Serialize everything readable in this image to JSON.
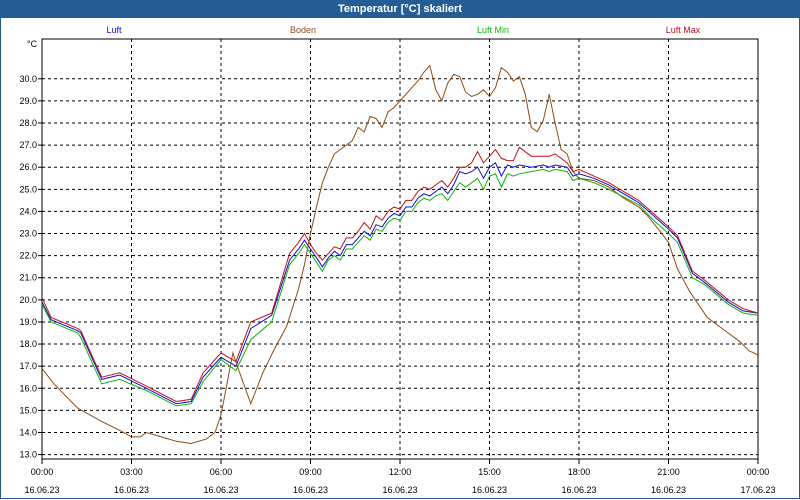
{
  "window": {
    "title": "Temperatur [°C] skaliert"
  },
  "chart_data": {
    "type": "line",
    "title": "Temperatur [°C] skaliert",
    "ylabel": "°C",
    "ylim": [
      12.8,
      31.8
    ],
    "yticks": [
      "13.0",
      "14.0",
      "15.0",
      "16.0",
      "17.0",
      "18.0",
      "19.0",
      "20.0",
      "21.0",
      "22.0",
      "23.0",
      "24.0",
      "25.0",
      "26.0",
      "27.0",
      "28.0",
      "29.0",
      "30.0"
    ],
    "xticks": [
      {
        "time": "00:00",
        "date": "16.06.23"
      },
      {
        "time": "03:00",
        "date": "16.06.23"
      },
      {
        "time": "06:00",
        "date": "16.06.23"
      },
      {
        "time": "09:00",
        "date": "16.06.23"
      },
      {
        "time": "12:00",
        "date": "16.06.23"
      },
      {
        "time": "15:00",
        "date": "16.06.23"
      },
      {
        "time": "18:00",
        "date": "16.06.23"
      },
      {
        "time": "21:00",
        "date": "16.06.23"
      },
      {
        "time": "00:00",
        "date": "17.06.23"
      }
    ],
    "x_range_hours": [
      0,
      24
    ],
    "grid": true,
    "series": [
      {
        "name": "Luft",
        "color": "#1010c8",
        "points": [
          [
            0,
            19.9
          ],
          [
            0.3,
            19.1
          ],
          [
            1.2,
            18.6
          ],
          [
            1.3,
            18.5
          ],
          [
            2.0,
            16.4
          ],
          [
            2.6,
            16.6
          ],
          [
            3.5,
            16.0
          ],
          [
            4.5,
            15.3
          ],
          [
            5.0,
            15.4
          ],
          [
            5.4,
            16.5
          ],
          [
            6.0,
            17.4
          ],
          [
            6.5,
            17.0
          ],
          [
            7.0,
            18.7
          ],
          [
            7.7,
            19.3
          ],
          [
            8.3,
            21.8
          ],
          [
            8.6,
            22.3
          ],
          [
            8.8,
            22.7
          ],
          [
            9.0,
            22.3
          ],
          [
            9.2,
            21.9
          ],
          [
            9.4,
            21.5
          ],
          [
            9.6,
            21.9
          ],
          [
            9.8,
            22.2
          ],
          [
            10.0,
            22.0
          ],
          [
            10.2,
            22.5
          ],
          [
            10.4,
            22.5
          ],
          [
            10.6,
            22.8
          ],
          [
            10.8,
            23.1
          ],
          [
            11.0,
            22.9
          ],
          [
            11.2,
            23.4
          ],
          [
            11.4,
            23.3
          ],
          [
            11.6,
            23.7
          ],
          [
            11.8,
            23.9
          ],
          [
            12.0,
            23.8
          ],
          [
            12.2,
            24.2
          ],
          [
            12.4,
            24.2
          ],
          [
            12.6,
            24.6
          ],
          [
            12.8,
            24.8
          ],
          [
            13.0,
            24.7
          ],
          [
            13.2,
            24.9
          ],
          [
            13.4,
            25.1
          ],
          [
            13.6,
            24.8
          ],
          [
            13.8,
            25.2
          ],
          [
            14.0,
            25.8
          ],
          [
            14.2,
            25.7
          ],
          [
            14.4,
            25.8
          ],
          [
            14.6,
            26.0
          ],
          [
            14.8,
            25.5
          ],
          [
            15.0,
            26.0
          ],
          [
            15.2,
            26.2
          ],
          [
            15.4,
            25.6
          ],
          [
            15.6,
            26.1
          ],
          [
            15.8,
            26.0
          ],
          [
            16.0,
            26.1
          ],
          [
            16.4,
            26.0
          ],
          [
            16.8,
            26.1
          ],
          [
            17.0,
            26.0
          ],
          [
            17.2,
            26.1
          ],
          [
            17.6,
            26.0
          ],
          [
            17.8,
            25.6
          ],
          [
            18.0,
            25.7
          ],
          [
            18.5,
            25.5
          ],
          [
            19.0,
            25.2
          ],
          [
            20.0,
            24.4
          ],
          [
            20.5,
            23.8
          ],
          [
            21.0,
            23.2
          ],
          [
            21.3,
            22.8
          ],
          [
            21.8,
            21.2
          ],
          [
            22.2,
            20.8
          ],
          [
            23.0,
            19.9
          ],
          [
            23.5,
            19.5
          ],
          [
            24.0,
            19.4
          ]
        ]
      },
      {
        "name": "Boden",
        "color": "#8b4c14",
        "points": [
          [
            0,
            16.9
          ],
          [
            0.4,
            16.2
          ],
          [
            1.2,
            15.1
          ],
          [
            2.0,
            14.5
          ],
          [
            2.6,
            14.1
          ],
          [
            3.0,
            13.8
          ],
          [
            3.3,
            13.8
          ],
          [
            3.5,
            14.0
          ],
          [
            4.0,
            13.8
          ],
          [
            4.5,
            13.6
          ],
          [
            5.0,
            13.5
          ],
          [
            5.5,
            13.7
          ],
          [
            5.8,
            14.0
          ],
          [
            6.0,
            14.8
          ],
          [
            6.2,
            16.2
          ],
          [
            6.4,
            17.6
          ],
          [
            6.6,
            16.8
          ],
          [
            7.0,
            15.3
          ],
          [
            7.4,
            16.7
          ],
          [
            7.8,
            17.8
          ],
          [
            8.2,
            18.8
          ],
          [
            8.6,
            20.5
          ],
          [
            8.8,
            21.6
          ],
          [
            9.0,
            23.0
          ],
          [
            9.2,
            24.2
          ],
          [
            9.4,
            25.3
          ],
          [
            9.6,
            26.0
          ],
          [
            9.8,
            26.6
          ],
          [
            10.0,
            26.8
          ],
          [
            10.2,
            27.0
          ],
          [
            10.4,
            27.2
          ],
          [
            10.6,
            27.8
          ],
          [
            10.8,
            27.6
          ],
          [
            11.0,
            28.3
          ],
          [
            11.2,
            28.2
          ],
          [
            11.4,
            27.8
          ],
          [
            11.6,
            28.5
          ],
          [
            11.8,
            28.7
          ],
          [
            12.0,
            29.0
          ],
          [
            12.2,
            29.3
          ],
          [
            12.4,
            29.6
          ],
          [
            12.6,
            29.9
          ],
          [
            12.8,
            30.3
          ],
          [
            13.0,
            30.6
          ],
          [
            13.2,
            29.5
          ],
          [
            13.4,
            29.0
          ],
          [
            13.6,
            29.8
          ],
          [
            13.8,
            30.2
          ],
          [
            14.0,
            30.1
          ],
          [
            14.2,
            29.4
          ],
          [
            14.4,
            29.2
          ],
          [
            14.6,
            29.3
          ],
          [
            14.8,
            29.5
          ],
          [
            15.0,
            29.2
          ],
          [
            15.2,
            29.6
          ],
          [
            15.4,
            30.5
          ],
          [
            15.6,
            30.3
          ],
          [
            15.8,
            29.9
          ],
          [
            16.0,
            30.1
          ],
          [
            16.2,
            29.3
          ],
          [
            16.4,
            27.8
          ],
          [
            16.6,
            27.6
          ],
          [
            16.8,
            28.1
          ],
          [
            17.0,
            29.3
          ],
          [
            17.2,
            28.0
          ],
          [
            17.4,
            26.8
          ],
          [
            17.6,
            26.6
          ],
          [
            17.8,
            25.8
          ],
          [
            18.0,
            25.5
          ],
          [
            18.5,
            25.4
          ],
          [
            19.0,
            25.1
          ],
          [
            19.5,
            24.6
          ],
          [
            20.0,
            24.2
          ],
          [
            20.3,
            23.8
          ],
          [
            20.6,
            23.3
          ],
          [
            21.0,
            22.6
          ],
          [
            21.3,
            21.4
          ],
          [
            21.7,
            20.4
          ],
          [
            22.0,
            19.8
          ],
          [
            22.3,
            19.2
          ],
          [
            22.7,
            18.8
          ],
          [
            23.0,
            18.5
          ],
          [
            23.4,
            18.1
          ],
          [
            23.7,
            17.7
          ],
          [
            24.0,
            17.5
          ]
        ]
      },
      {
        "name": "Luft Min",
        "color": "#10b010",
        "points": [
          [
            0,
            19.8
          ],
          [
            0.3,
            19.0
          ],
          [
            1.2,
            18.5
          ],
          [
            1.3,
            18.3
          ],
          [
            2.0,
            16.2
          ],
          [
            2.6,
            16.4
          ],
          [
            3.5,
            15.9
          ],
          [
            4.5,
            15.2
          ],
          [
            5.0,
            15.3
          ],
          [
            5.4,
            16.3
          ],
          [
            6.0,
            17.3
          ],
          [
            6.5,
            16.8
          ],
          [
            7.0,
            18.2
          ],
          [
            7.7,
            19.0
          ],
          [
            8.3,
            21.6
          ],
          [
            8.6,
            22.1
          ],
          [
            8.8,
            22.5
          ],
          [
            9.0,
            22.1
          ],
          [
            9.2,
            21.7
          ],
          [
            9.4,
            21.3
          ],
          [
            9.6,
            21.8
          ],
          [
            9.8,
            22.0
          ],
          [
            10.0,
            21.8
          ],
          [
            10.2,
            22.3
          ],
          [
            10.4,
            22.3
          ],
          [
            10.6,
            22.6
          ],
          [
            10.8,
            22.9
          ],
          [
            11.0,
            22.7
          ],
          [
            11.2,
            23.2
          ],
          [
            11.4,
            23.1
          ],
          [
            11.6,
            23.5
          ],
          [
            11.8,
            23.7
          ],
          [
            12.0,
            23.6
          ],
          [
            12.2,
            24.0
          ],
          [
            12.4,
            24.0
          ],
          [
            12.6,
            24.4
          ],
          [
            12.8,
            24.6
          ],
          [
            13.0,
            24.5
          ],
          [
            13.2,
            24.7
          ],
          [
            13.4,
            24.8
          ],
          [
            13.6,
            24.5
          ],
          [
            13.8,
            24.9
          ],
          [
            14.0,
            25.3
          ],
          [
            14.2,
            25.1
          ],
          [
            14.4,
            25.3
          ],
          [
            14.6,
            25.5
          ],
          [
            14.8,
            25.0
          ],
          [
            15.0,
            25.6
          ],
          [
            15.2,
            25.7
          ],
          [
            15.4,
            25.1
          ],
          [
            15.6,
            25.7
          ],
          [
            15.8,
            25.6
          ],
          [
            16.0,
            25.7
          ],
          [
            16.4,
            25.8
          ],
          [
            16.8,
            25.9
          ],
          [
            17.0,
            25.8
          ],
          [
            17.2,
            25.9
          ],
          [
            17.6,
            25.8
          ],
          [
            17.8,
            25.4
          ],
          [
            18.0,
            25.5
          ],
          [
            18.5,
            25.3
          ],
          [
            19.0,
            25.0
          ],
          [
            20.0,
            24.3
          ],
          [
            20.5,
            23.6
          ],
          [
            21.0,
            23.0
          ],
          [
            21.3,
            22.6
          ],
          [
            21.8,
            21.0
          ],
          [
            22.2,
            20.7
          ],
          [
            23.0,
            19.8
          ],
          [
            23.5,
            19.4
          ],
          [
            24.0,
            19.3
          ]
        ]
      },
      {
        "name": "Luft Max",
        "color": "#c0101c",
        "points": [
          [
            0,
            20.1
          ],
          [
            0.3,
            19.2
          ],
          [
            1.2,
            18.7
          ],
          [
            1.3,
            18.6
          ],
          [
            2.0,
            16.5
          ],
          [
            2.6,
            16.7
          ],
          [
            3.5,
            16.1
          ],
          [
            4.5,
            15.4
          ],
          [
            5.0,
            15.5
          ],
          [
            5.4,
            16.7
          ],
          [
            6.0,
            17.6
          ],
          [
            6.5,
            17.2
          ],
          [
            7.0,
            19.0
          ],
          [
            7.7,
            19.4
          ],
          [
            8.3,
            22.1
          ],
          [
            8.6,
            22.6
          ],
          [
            8.8,
            23.0
          ],
          [
            9.0,
            22.5
          ],
          [
            9.2,
            22.1
          ],
          [
            9.4,
            21.8
          ],
          [
            9.6,
            22.1
          ],
          [
            9.8,
            22.4
          ],
          [
            10.0,
            22.3
          ],
          [
            10.2,
            22.8
          ],
          [
            10.4,
            22.8
          ],
          [
            10.6,
            23.1
          ],
          [
            10.8,
            23.5
          ],
          [
            11.0,
            23.2
          ],
          [
            11.2,
            23.8
          ],
          [
            11.4,
            23.6
          ],
          [
            11.6,
            24.0
          ],
          [
            11.8,
            24.2
          ],
          [
            12.0,
            24.1
          ],
          [
            12.2,
            24.5
          ],
          [
            12.4,
            24.5
          ],
          [
            12.6,
            24.9
          ],
          [
            12.8,
            25.1
          ],
          [
            13.0,
            25.0
          ],
          [
            13.2,
            25.2
          ],
          [
            13.4,
            25.4
          ],
          [
            13.6,
            25.1
          ],
          [
            13.8,
            25.5
          ],
          [
            14.0,
            26.0
          ],
          [
            14.2,
            26.0
          ],
          [
            14.4,
            26.2
          ],
          [
            14.6,
            26.7
          ],
          [
            14.8,
            26.2
          ],
          [
            15.0,
            26.5
          ],
          [
            15.2,
            26.8
          ],
          [
            15.4,
            26.4
          ],
          [
            15.6,
            26.3
          ],
          [
            15.8,
            26.3
          ],
          [
            16.0,
            26.9
          ],
          [
            16.4,
            26.5
          ],
          [
            16.8,
            26.5
          ],
          [
            17.0,
            26.5
          ],
          [
            17.2,
            26.6
          ],
          [
            17.6,
            26.2
          ],
          [
            17.8,
            25.8
          ],
          [
            18.0,
            25.9
          ],
          [
            18.5,
            25.6
          ],
          [
            19.0,
            25.3
          ],
          [
            20.0,
            24.5
          ],
          [
            20.5,
            23.9
          ],
          [
            21.0,
            23.3
          ],
          [
            21.3,
            22.9
          ],
          [
            21.8,
            21.3
          ],
          [
            22.2,
            20.9
          ],
          [
            23.0,
            20.0
          ],
          [
            23.5,
            19.6
          ],
          [
            24.0,
            19.4
          ]
        ]
      }
    ]
  }
}
